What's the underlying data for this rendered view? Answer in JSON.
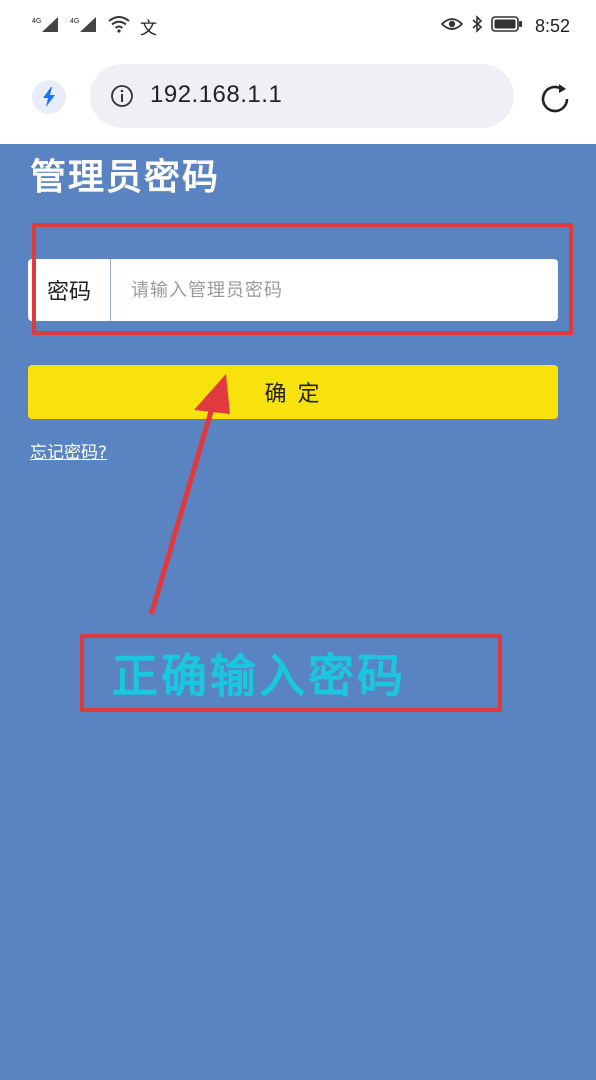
{
  "status_bar": {
    "carrier_text": "文",
    "time": "8:52"
  },
  "browser": {
    "url": "192.168.1.1"
  },
  "page": {
    "title": "管理员密码",
    "password_label": "密码",
    "password_placeholder": "请输入管理员密码",
    "password_value": "",
    "confirm_button": "确    定",
    "forgot_link": "忘记密码?"
  },
  "annotation": {
    "callout_text": "正确输入密码",
    "highlight_color": "#e0393e",
    "callout_color": "#19c7e0"
  },
  "colors": {
    "page_background": "#5a83c2",
    "button_yellow": "#f7e20c"
  },
  "icons": [
    "signal-icon",
    "wifi-icon",
    "eye-icon",
    "bluetooth-icon",
    "battery-icon",
    "bolt-icon",
    "info-icon",
    "reload-icon",
    "arrow-icon"
  ]
}
